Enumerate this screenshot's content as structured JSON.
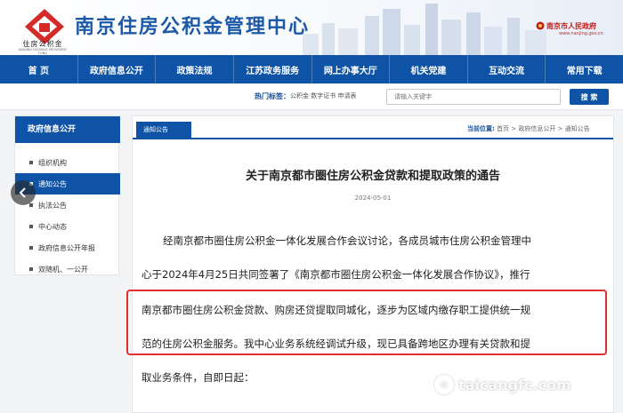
{
  "header": {
    "site_title": "南京住房公积金管理中心",
    "logo_text": "住房公积金",
    "logo_sub": "NANJING HOUSING PROVIDENT FUND",
    "gov_text": "南京市人民政府",
    "gov_url": "www.nanjing.gov.cn"
  },
  "nav": {
    "items": [
      "首 页",
      "政府信息公开",
      "政策法规",
      "江苏政务服务",
      "网上办事大厅",
      "机关党建",
      "互动交流",
      "常用下载"
    ]
  },
  "search": {
    "hot_label": "热门标签：",
    "hot_words": "公积金  数字证书  申请表",
    "placeholder": "请输入关键字",
    "button": "搜 索"
  },
  "sidebar": {
    "title": "政府信息公开",
    "items": [
      {
        "label": "组织机构"
      },
      {
        "label": "通知公告"
      },
      {
        "label": "执法公告"
      },
      {
        "label": "中心动态"
      },
      {
        "label": "政府信息公开年报"
      },
      {
        "label": "双随机、一公开"
      }
    ]
  },
  "main": {
    "tab": "通知公告",
    "crumb_label": "当前位置:",
    "crumb_path": "首页 > 政府信息公开 > 通知公告",
    "title": "关于南京都市圈住房公积金贷款和提取政策的通告",
    "date": "2024-05-01",
    "paragraph_lines": [
      "经南京都市圈住房公积金一体化发展合作会议讨论，各成员城市住房公积金管理中",
      "心于2024年4月25日共同签署了《南京都市圈住房公积金一体化发展合作协议》，推行",
      "南京都市圈住房公积金贷款、购房还贷提取同城化，逐步为区域内缴存职工提供统一规",
      "范的住房公积金服务。我中心业务系统经调试升级，现已具备跨地区办理有关贷款和提",
      "取业务条件，自即日起："
    ]
  },
  "watermark": {
    "text": "taicangfc.com"
  }
}
